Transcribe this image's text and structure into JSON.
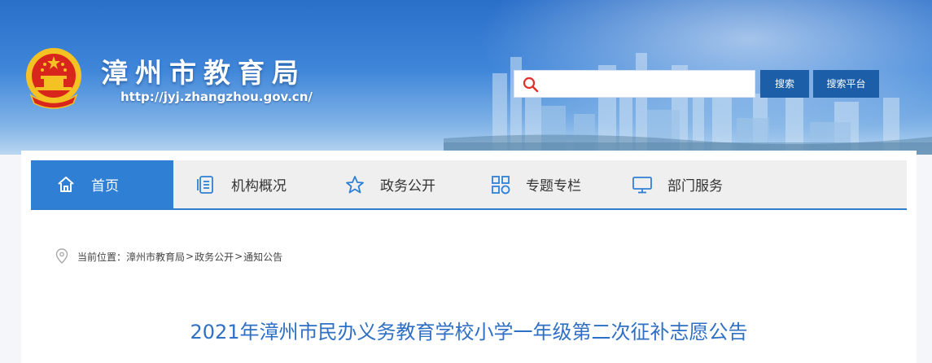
{
  "header": {
    "site_title": "漳州市教育局",
    "site_url": "http://jyj.zhangzhou.gov.cn/",
    "search": {
      "placeholder": "",
      "value": ""
    },
    "search_button": "搜索",
    "platform_button": "搜索平台"
  },
  "nav": {
    "items": [
      {
        "label": "首页",
        "icon": "home-icon",
        "active": true
      },
      {
        "label": "机构概况",
        "icon": "document-list-icon",
        "active": false
      },
      {
        "label": "政务公开",
        "icon": "star-icon",
        "active": false
      },
      {
        "label": "专题专栏",
        "icon": "grid-icon",
        "active": false
      },
      {
        "label": "部门服务",
        "icon": "monitor-icon",
        "active": false
      }
    ]
  },
  "breadcrumb": {
    "prefix": "当前位置：",
    "items": [
      "漳州市教育局",
      "政务公开",
      "通知公告"
    ],
    "separator": ">"
  },
  "article": {
    "title": "2021年漳州市民办义务教育学校小学一年级第二次征补志愿公告"
  },
  "colors": {
    "primary_blue": "#2f80d5",
    "title_blue": "#2f6fc4",
    "button_blue": "#1c5ea8",
    "search_icon_red": "#e0302a"
  }
}
